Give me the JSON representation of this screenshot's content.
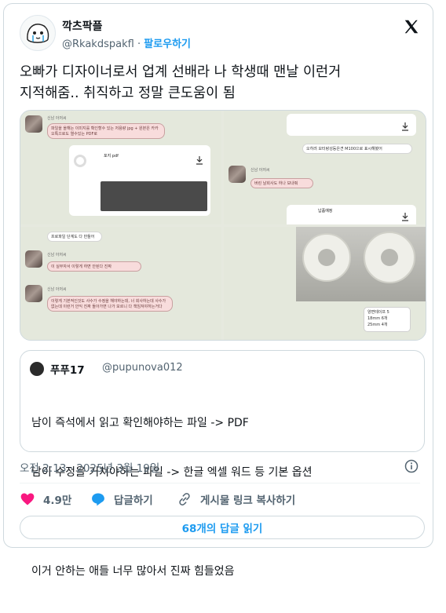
{
  "author": {
    "name": "깍츠팍플",
    "handle": "@Rkakdspakfl",
    "separator": "·",
    "follow_label": "팔로우하기"
  },
  "tweet": {
    "lines": [
      "오빠가 디자이너로서 업계 선배라 나 학생때 맨날 이런거",
      "지적해줌.. 취직하고 정말 큰도움이 됨"
    ]
  },
  "media": {
    "sender": "신남 아저씨",
    "bubble_1": "파일을 올해는 이미지를 확인할수 있는 저용량 jpg + 원본은 카카오톡으로도 열수있는 PDF로",
    "file_1_name": "포지 pdf",
    "file_2_line": "오히려 모터랑성등은견 M100으로 표시해봤어",
    "bubble_2": "버린 날회사도 하나 보내줘",
    "file_3_name": "납품예정",
    "bubble_3": "프로파일 단계도 다 만들어",
    "bubble_4": "이 실무자서 이렇게 하면 안된다 진짜",
    "bubble_5": "이렇게 기본적인것도 사수가 수정을 해야하는데, 너 회사하는데 사수가 없는데 이런거 안익 진짜 돌아가면 나가 모르니 다 책임져야하는거다",
    "label_1": "양면테이프 5",
    "label_2": "18mm 6개",
    "label_3": "25mm 4개"
  },
  "quote": {
    "name": "푸푸17",
    "handle": "@pupunova012",
    "lines": [
      "남이 즉석에서 읽고 확인해야하는 파일 -> PDF",
      "남이 수정을 거쳐야하는 파일 -> 한글 엑셀 워드 등 기본 옵션",
      "",
      "이거 안하는 애들 너무 많아서 진짜 힘들었음"
    ]
  },
  "meta": {
    "timestamp": "오전 2:13 · 2025년 3월 19일"
  },
  "actions": {
    "likes": "4.9만",
    "reply_label": "답글하기",
    "copy_link_label": "게시물 링크 복사하기"
  },
  "replies_button": "68개의 답글 읽기",
  "colors": {
    "accent": "#1d9bf0",
    "like": "#f91880",
    "text": "#0f1419",
    "muted": "#536471"
  },
  "icons": [
    "x-logo-icon",
    "info-icon",
    "heart-icon",
    "reply-icon",
    "link-icon",
    "download-icon"
  ]
}
